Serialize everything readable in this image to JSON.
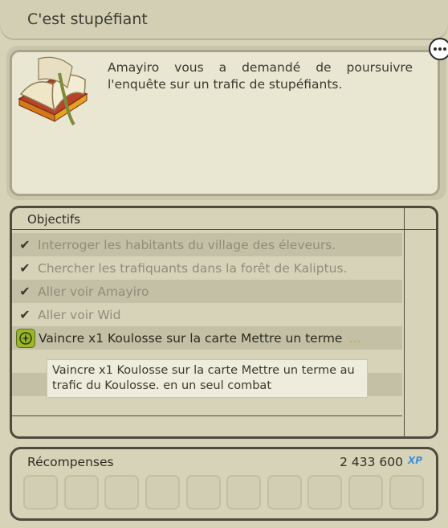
{
  "window": {
    "title": "C'est stupéfiant"
  },
  "quest": {
    "description": "Amayiro vous a demandé de poursuivre l'enquête sur un trafic de stupéfiants.",
    "icon": "open-book-icon"
  },
  "objectives": {
    "header": "Objectifs",
    "items": [
      {
        "label": "Interroger les habitants du village des éleveurs.",
        "status": "done",
        "icon": "checkmark-icon"
      },
      {
        "label": "Chercher les trafiquants dans la forêt de Kaliptus.",
        "status": "done",
        "icon": "checkmark-icon"
      },
      {
        "label": "Aller voir Amayiro",
        "status": "done",
        "icon": "checkmark-icon"
      },
      {
        "label": "Aller voir Wid",
        "status": "done",
        "icon": "checkmark-icon"
      },
      {
        "label": "Vaincre x1 Koulosse sur la carte Mettre un terme",
        "status": "active",
        "icon": "compass-icon",
        "more": "..."
      }
    ],
    "tooltip": "Vaincre x1 Koulosse sur la carte Mettre un terme au trafic du Koulosse. en un seul combat"
  },
  "rewards": {
    "label": "Récompenses",
    "xp": "2 433 600",
    "xp_icon_label": "XP",
    "slot_count": 10
  },
  "colors": {
    "background": "#d7d3b9",
    "frame_dark": "#4e4a3c",
    "row_shade": "#c4c0a5",
    "done_text": "#8f8c7b",
    "accent_gold": "#d3a629",
    "xp_blue": "#3c8fd9"
  }
}
